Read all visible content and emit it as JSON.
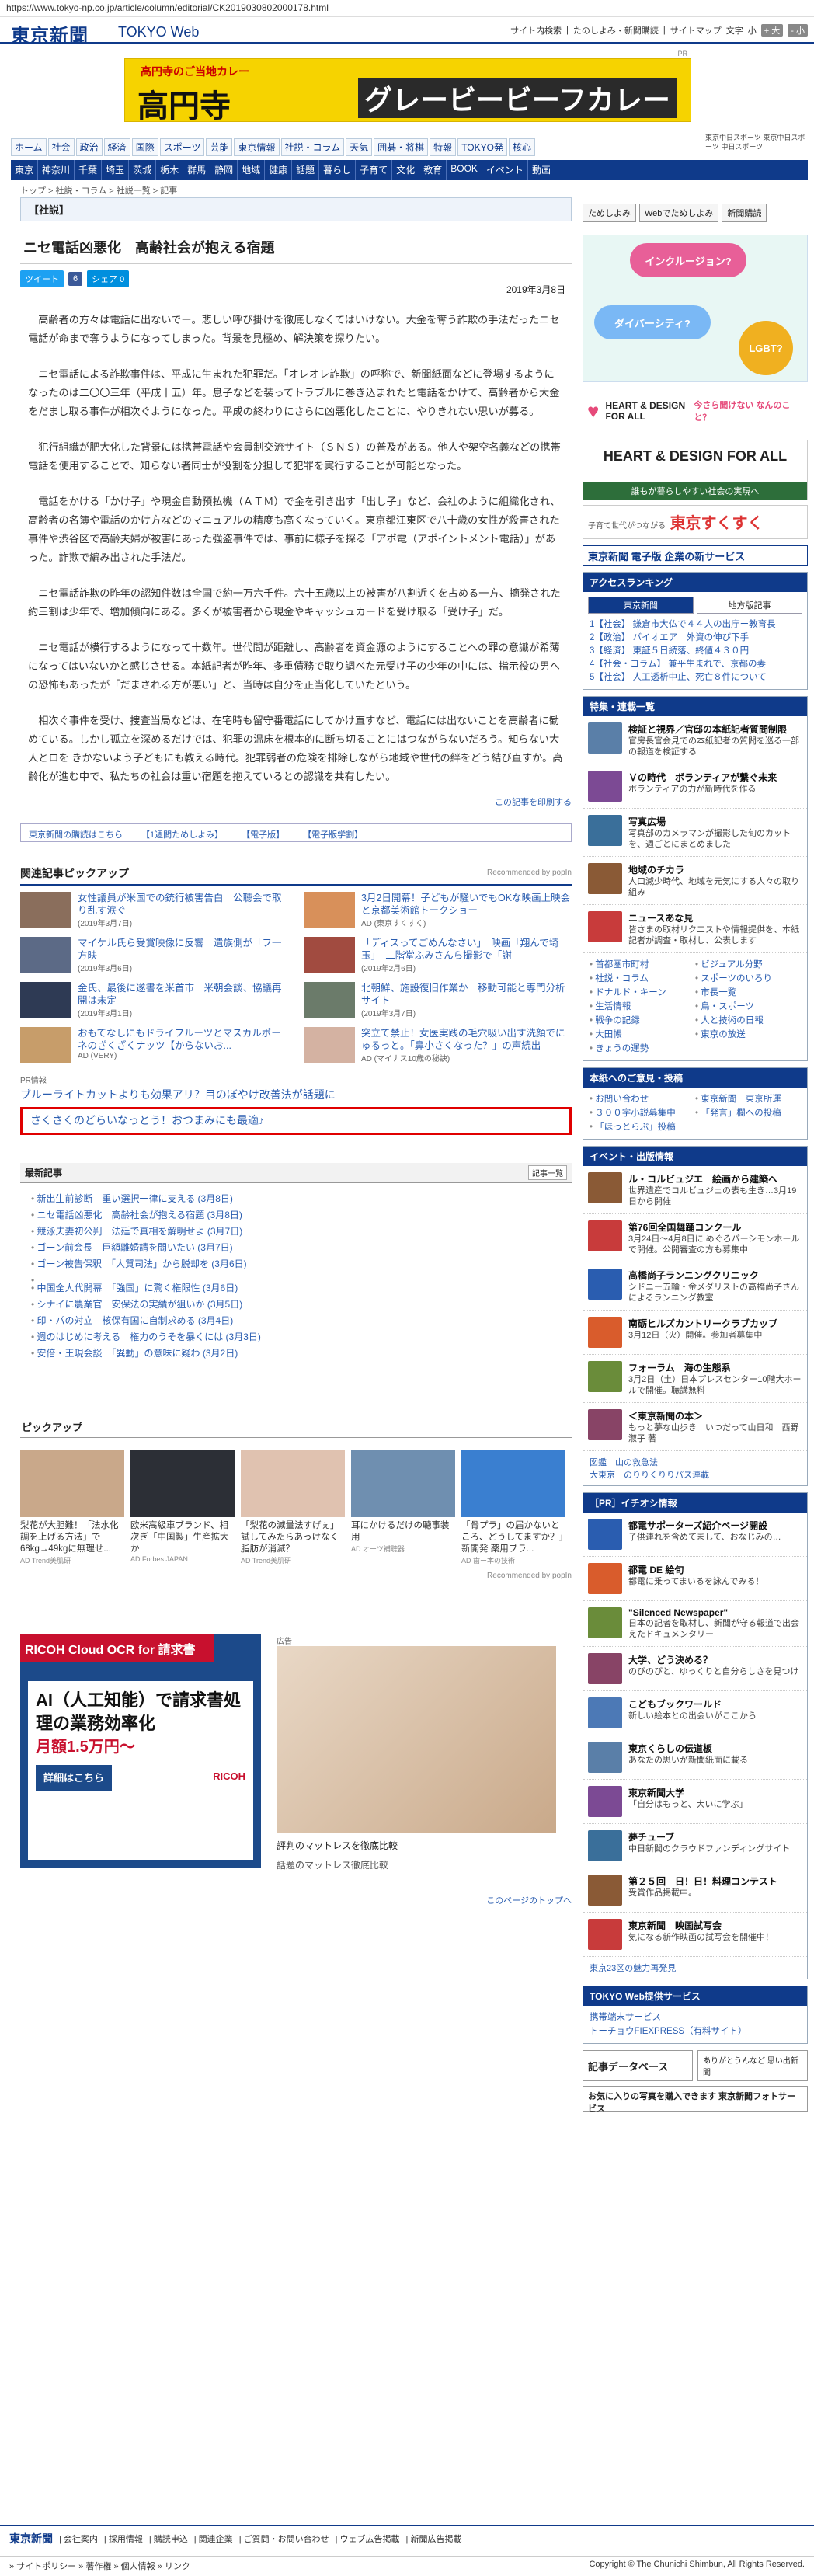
{
  "url": "https://www.tokyo-np.co.jp/article/column/editorial/CK2019030802000178.html",
  "site": {
    "logo": "東京新聞",
    "sub": "TOKYO Web"
  },
  "util": {
    "items": [
      "サイト内検索",
      "たのしよみ・新聞購読",
      "サイトマップ"
    ],
    "fontsize": "文字",
    "small": "小",
    "plus": "+ 大",
    "minus": "- 小"
  },
  "banner": {
    "line1": "高円寺のご当地カレー",
    "line2": "高円寺",
    "line3": "グレービービーフカレー",
    "note": "PR"
  },
  "sidead": "東京中日スポーツ 東京中日スポーツ 中日スポーツ",
  "nav1": [
    "ホーム",
    "社会",
    "政治",
    "経済",
    "国際",
    "スポーツ",
    "芸能",
    "東京情報",
    "社説・コラム",
    "天気",
    "囲碁・将棋",
    "特報",
    "TOKYO発",
    "核心"
  ],
  "nav2": [
    "東京",
    "神奈川",
    "千葉",
    "埼玉",
    "茨城",
    "栃木",
    "群馬",
    "静岡",
    "地域",
    "健康",
    "話題",
    "暮らし",
    "子育て",
    "文化",
    "教育",
    "BOOK",
    "イベント",
    "動画"
  ],
  "crumb": "トップ > 社説・コラム > 社説一覧 > 記事",
  "section": "【社説】",
  "title": "ニセ電話凶悪化　高齢社会が抱える宿題",
  "date": "2019年3月8日",
  "share": {
    "tweet": "ツイート",
    "fb": "6",
    "hatena": "シェア 0"
  },
  "paragraphs": [
    "高齢者の方々は電話に出ないでー。悲しい呼び掛けを徹底しなくてはいけない。大金を奪う詐欺の手法だったニセ電話が命まで奪うようになってしまった。背景を見極め、解決策を探りたい。",
    "ニセ電話による詐欺事件は、平成に生まれた犯罪だ。「オレオレ詐欺」の呼称で、新聞紙面などに登場するようになったのは二〇〇三年（平成十五）年。息子などを装ってトラブルに巻き込まれたと電話をかけて、高齢者から大金をだまし取る事件が相次ぐようになった。平成の終わりにさらに凶悪化したことに、やりきれない思いが募る。",
    "犯行組織が肥大化した背景には携帯電話や会員制交流サイト（ＳＮＳ）の普及がある。他人や架空名義などの携帯電話を使用することで、知らない者同士が役割を分担して犯罪を実行することが可能となった。",
    "電話をかける「かけ子」や現金自動預払機（ＡＴＭ）で金を引き出す「出し子」など、会社のように組織化され、高齢者の名簿や電話のかけ方などのマニュアルの精度も高くなっていく。東京都江東区で八十歳の女性が殺害された事件や渋谷区で高齢夫婦が被害にあった強盗事件では、事前に様子を探る「アポ電（アポイントメント電話）」があった。詐欺で編み出された手法だ。",
    "ニセ電話詐欺の昨年の認知件数は全国で約一万六千件。六十五歳以上の被害が八割近くを占める一方、摘発された約三割は少年で、増加傾向にある。多くが被害者から現金やキャッシュカードを受け取る「受け子」だ。",
    "ニセ電話が横行するようになって十数年。世代間が距離し、高齢者を資金源のようにすることへの罪の意識が希薄になってはいないかと感じさせる。本紙記者が昨年、多重債務で取り調べた元受け子の少年の中には、指示役の男への恐怖もあったが「だまされる方が悪い」と、当時は自分を正当化していたという。",
    "相次ぐ事件を受け、捜査当局などは、在宅時も留守番電話にしてかけ直すなど、電話には出ないことを高齢者に勧めている。しかし孤立を深めるだけでは、犯罪の温床を根本的に断ち切ることにはつながらないだろう。知らない大人とロを きかないよう子どもにも教える時代。犯罪弱者の危険を排除しながら地域や世代の絆をどう結び直すか。高齢化が進む中で、私たちの社会は重い宿題を抱えているとの認識を共有したい。"
  ],
  "print": "この記事を印刷する",
  "links": [
    "東京新聞の購読はこちら",
    "【1週間ためしよみ】",
    "【電子版】",
    "【電子版学割】"
  ],
  "pickup": {
    "title": "関連記事ピックアップ",
    "rec": "Recommended by popIn",
    "items": [
      {
        "t": "女性議員が米国での銃行被害告白　公聴会で取り乱す涙ぐ",
        "s": "(2019年3月7日)"
      },
      {
        "t": "3月2日開幕！子どもが騒いでもOKな映画上映会と京都美術館トークショー",
        "s": "AD (東京すくすく)"
      },
      {
        "t": "マイケル氏ら受賞映像に反響　遺族側が「フ一方映",
        "s": "(2019年3月6日)"
      },
      {
        "t": "「ディスってごめんなさい」　映画「翔んで埼玉」　二階堂ふみさんら撮影で「謝",
        "s": "(2019年2月6日)"
      },
      {
        "t": "金氏、最後に遂書を米首市　米朝会談、協議再開は未定",
        "s": "(2019年3月1日)"
      },
      {
        "t": "北朝鮮、施設復旧作業か　移動可能と専門分析サイト",
        "s": "(2019年3月7日)"
      },
      {
        "t": "おもてなしにもドライフルーツとマスカルポーネのざくざくナッツ【からないお...",
        "s": "AD (VERY)"
      },
      {
        "t": "突立て禁止！女医実践の毛穴吸い出す洗顔でにゅるっと。「鼻小さくなった？」の声続出",
        "s": "AD (マイナス10歳の秘訣)"
      }
    ]
  },
  "pr": {
    "label": "PR情報",
    "link1": "ブルーライトカットよりも効果アリ？目のぼやけ改善法が話題に",
    "link2": "さくさくのどらいなっとう！おつまみにも最適♪"
  },
  "news": {
    "title": "最新記事",
    "list_btn": "記事一覧",
    "items": [
      "新出生前診断　重い選択一律に支える (3月8日)",
      "ニセ電話凶悪化　高齢社会が抱える宿題 (3月8日)",
      "競泳夫妻初公判　法廷で真相を解明せよ (3月7日)",
      "ゴーン前会長　巨額離婚請を問いたい (3月7日)",
      "ゴーン被告保釈　「人質司法」から脱却を (3月6日)",
      "中国全人代開幕　「強国」に驚く権限性 (3月6日)",
      "シナイに農業官　安保法の実績が狙いか (3月5日)",
      "印・パの対立　核保有国に自制求める (3月4日)",
      "週のはじめに考える　権力のうそを暴くには (3月3日)",
      "安倍・王現会談　「異動」の意味に疑わ (3月2日)"
    ]
  },
  "pickup2": {
    "title": "ピックアップ",
    "items": [
      {
        "t": "梨花が大胆難！「法水化調を上げる方法」で68kg→49kgに無理せ...",
        "s": "AD Trend美肌研"
      },
      {
        "t": "欧米高級車ブランド、相次ぎ「中国製」生産拡大か",
        "s": "AD Forbes JAPAN"
      },
      {
        "t": "「梨花の減量法すげぇ」試してみたらあっけなく脂肪が消滅？",
        "s": "AD Trend美肌研"
      },
      {
        "t": "耳にかけるだけの聴事装用",
        "s": "AD オーツ補聴器"
      },
      {
        "t": "「骨プラ」の届かないところ、どうしてますか？」新開発 薬用ブラ...",
        "s": "AD 歯ー本の技術"
      }
    ],
    "rec": "Recommended by popIn"
  },
  "ricoh": {
    "head": "RICOH Cloud OCR for 請求書",
    "body": "AI（人工知能）で請求書処理の業務効率化",
    "price": "月額1.5万円～",
    "btn": "詳細はこちら",
    "logo": "RICOH"
  },
  "sleep": {
    "caption": "評判のマットレスを徹底比較",
    "footer": "話題のマットレス徹底比較",
    "ad": "広告"
  },
  "totop": "このページのトップへ",
  "right": {
    "btns": [
      "ためしよみ",
      "Webでためしよみ",
      "新聞購読"
    ],
    "bubbles": [
      "インクルージョン?",
      "ダイバーシティ?",
      "LGBT?"
    ],
    "heart": "HEART & DESIGN FOR ALL",
    "heart_sub": "今さら聞けない なんのこと？",
    "heart2": "HEART & DESIGN FOR ALL",
    "heart2_sub": "誰もが暮らしやすい社会の実現へ",
    "suku_pre": "子育て世代がつながる",
    "suku": "東京すくすく",
    "digital": "東京新聞 電子版 企業の新サービス",
    "ranking_title": "アクセスランキング",
    "tab_tokyo": "東京新聞",
    "tab_local": "地方版記事",
    "ranking": [
      "1【社会】 鎌倉市大仏で４４人の出庁ー教育長",
      "2【政治】 バイオエア　外資の伸び下手",
      "3【経済】 東証５日続落、終値４３０円",
      "4【社会・コラム】 兼平生まれで、京都の妻",
      "5【社会】 人工透析中止、死亡８件について"
    ],
    "features_title": "特集・連載一覧",
    "features": [
      {
        "t": "検証と視界／官邸の本紙記者質問制限",
        "d": "官房長官会見での本紙記者の質問を巡る一部の報道を検証する"
      },
      {
        "t": "Ｖの時代　ボランティアが繋ぐ未来",
        "d": "ボランティアの力が新時代を作る"
      },
      {
        "t": "写真広場",
        "d": "写真部のカメラマンが撮影した旬のカットを、週ごとにまとめました"
      },
      {
        "t": "地域のチカラ",
        "d": "人口減少時代、地域を元気にする人々の取り組み"
      },
      {
        "t": "ニュースあな見",
        "d": "皆さまの取材リクエストや情報提供を、本紙記者が調査・取材し、公表します"
      }
    ],
    "links2": [
      "首都圏市町村",
      "ビジュアル分野",
      "社説・コラム",
      "スポーツのいろり",
      "ドナルド・キーン",
      "市長一覧",
      "生活情報",
      "鳥・スポーツ",
      "戦争の記録",
      "人と技術の日報",
      "大田帳",
      "東京の放送",
      "きょうの運勢"
    ],
    "readers_title": "本紙へのご意見・投稿",
    "readers": [
      "お問い合わせ",
      "東京新聞　東京所運",
      "３００字小説募集中",
      "「発言」欄への投稿",
      "「ほっとらぶ」投稿"
    ],
    "events_title": "イベント・出版情報",
    "events": [
      {
        "t": "ル・コルビュジエ　絵画から建築へ",
        "d": "世界遺産でコルビュジェの表も生き…3月19日から開催"
      },
      {
        "t": "第76回全国舞踊コンクール",
        "d": "3月24日～4月8日に めぐろパーシモンホールで開催。公開審査の方も募集中"
      },
      {
        "t": "高橋尚子ランニングクリニック",
        "d": "シドニー五輪・金メダリストの高橋尚子さんによるランニング教室"
      },
      {
        "t": "南砺ヒルズカントリークラブカップ",
        "d": "3月12日（火）開催。参加者募集中"
      },
      {
        "t": "フォーラム　海の生態系",
        "d": "3月2日（土）日本プレスセンター10階大ホールで開催。聴講無料"
      },
      {
        "t": "＜東京新聞の本＞",
        "d": "もっと夢な山歩き　いつだって山日和　西野淑子 著"
      }
    ],
    "books_extra": "図鑑　山の救急法\n大東京　のりりくりりパス連載",
    "pr_title": "［PR］イチオシ情報",
    "pr_items": [
      {
        "t": "都電サポーターズ紹介ページ開設",
        "d": "子供連れを含めてまして、おなじみの…"
      },
      {
        "t": "都電 DE 絵旬",
        "d": "都電に乗ってまいるを詠んでみる！"
      },
      {
        "t": "\"Silenced Newspaper\"",
        "d": "日本の記者を取材し、新聞が守る報道で出会えたドキュメンタリー"
      },
      {
        "t": "大学、どう決める？",
        "d": "のびのびと、ゆっくりと自分らしさを見つけ"
      },
      {
        "t": "こどもブックワールド",
        "d": "新しい絵本との出会いがここから"
      },
      {
        "t": "東京くらしの伝道板",
        "d": "あなたの思いが新聞紙面に載る"
      },
      {
        "t": "東京新聞大学",
        "d": "「自分はもっと、大いに学ぶ」"
      },
      {
        "t": "夢チューブ",
        "d": "中日新聞のクラウドファンディングサイト"
      },
      {
        "t": "第２５回　日！日！料理コンテスト",
        "d": "受賞作品掲載中。"
      },
      {
        "t": "東京新聞　映画試写会",
        "d": "気になる新作映画の試写会を開催中！"
      }
    ],
    "sites_more": "東京23区の魅力再発見",
    "services_title": "TOKYO Web提供サービス",
    "services": [
      "携帯端末サービス",
      "トーチョウFIEXPRESS（有料サイト）"
    ],
    "db": "記事データベース",
    "kiosk": "ありがとうんなど 思い出新聞",
    "photo": "お気に入りの写真を購入できます 東京新聞フォトサービス"
  },
  "footer": {
    "logo": "東京新聞",
    "links": [
      "会社案内",
      "採用情報",
      "購読申込",
      "関連企業",
      "ご質問・お問い合わせ",
      "ウェブ広告掲載",
      "新聞広告掲載"
    ],
    "links2": [
      "サイトポリシー",
      "著作権",
      "個人情報",
      "リンク"
    ],
    "copy": "Copyright © The Chunichi Shimbun, All Rights Reserved."
  }
}
